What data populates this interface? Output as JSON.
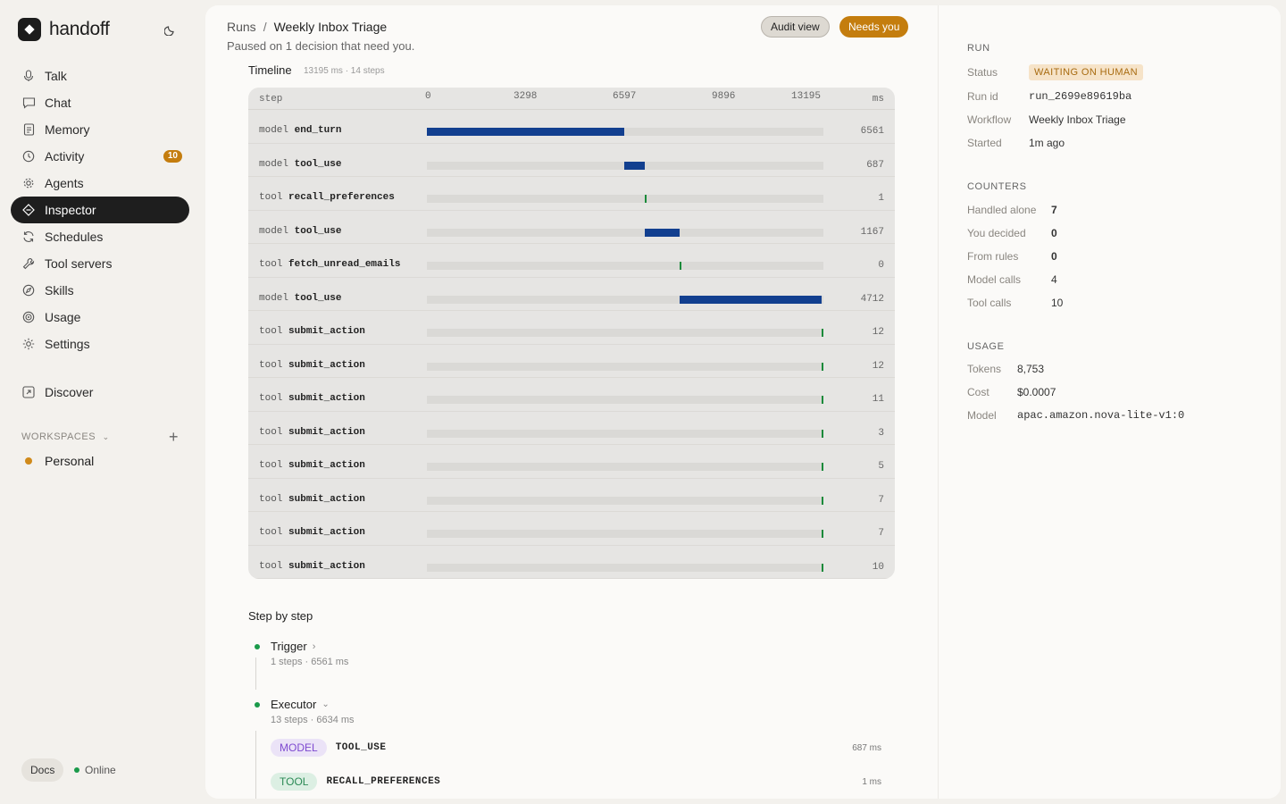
{
  "app": {
    "name": "handoff"
  },
  "nav": [
    {
      "label": "Talk",
      "icon": "mic-icon"
    },
    {
      "label": "Chat",
      "icon": "chat-icon"
    },
    {
      "label": "Memory",
      "icon": "document-icon"
    },
    {
      "label": "Activity",
      "icon": "clock-icon",
      "badge": "10"
    },
    {
      "label": "Agents",
      "icon": "gear-cog-icon"
    },
    {
      "label": "Inspector",
      "icon": "diamond-icon",
      "active": true
    },
    {
      "label": "Schedules",
      "icon": "refresh-icon"
    },
    {
      "label": "Tool servers",
      "icon": "wrench-icon"
    },
    {
      "label": "Skills",
      "icon": "compass-icon"
    },
    {
      "label": "Usage",
      "icon": "target-icon"
    },
    {
      "label": "Settings",
      "icon": "sun-gear-icon"
    }
  ],
  "discover": {
    "label": "Discover"
  },
  "workspaces": {
    "label": "WORKSPACES",
    "items": [
      "Personal"
    ]
  },
  "footer": {
    "docs": "Docs",
    "status": "Online"
  },
  "header": {
    "crumb_root": "Runs",
    "crumb_sep": "/",
    "crumb_current": "Weekly Inbox Triage",
    "subtitle": "Paused on 1 decision that need you.",
    "audit_label": "Audit view",
    "needs_label": "Needs you"
  },
  "timeline": {
    "title": "Timeline",
    "meta": "13195 ms · 14 steps",
    "col_step": "step",
    "col_ms": "ms",
    "ticks": [
      "0",
      "3298",
      "6597",
      "9896",
      "13195"
    ],
    "total_ms": 13195,
    "rows": [
      {
        "kind": "model",
        "name": "end_turn",
        "start": 0,
        "dur": 6561,
        "value": "6561"
      },
      {
        "kind": "model",
        "name": "tool_use",
        "start": 6561,
        "dur": 687,
        "value": "687"
      },
      {
        "kind": "tool",
        "name": "recall_preferences",
        "start": 7248,
        "dur": 1,
        "value": "1"
      },
      {
        "kind": "model",
        "name": "tool_use",
        "start": 7249,
        "dur": 1167,
        "value": "1167"
      },
      {
        "kind": "tool",
        "name": "fetch_unread_emails",
        "start": 8416,
        "dur": 0,
        "value": "0"
      },
      {
        "kind": "model",
        "name": "tool_use",
        "start": 8416,
        "dur": 4712,
        "value": "4712"
      },
      {
        "kind": "tool",
        "name": "submit_action",
        "start": 13128,
        "dur": 12,
        "value": "12"
      },
      {
        "kind": "tool",
        "name": "submit_action",
        "start": 13140,
        "dur": 12,
        "value": "12"
      },
      {
        "kind": "tool",
        "name": "submit_action",
        "start": 13152,
        "dur": 11,
        "value": "11"
      },
      {
        "kind": "tool",
        "name": "submit_action",
        "start": 13163,
        "dur": 3,
        "value": "3"
      },
      {
        "kind": "tool",
        "name": "submit_action",
        "start": 13166,
        "dur": 5,
        "value": "5"
      },
      {
        "kind": "tool",
        "name": "submit_action",
        "start": 13171,
        "dur": 7,
        "value": "7"
      },
      {
        "kind": "tool",
        "name": "submit_action",
        "start": 13178,
        "dur": 7,
        "value": "7"
      },
      {
        "kind": "tool",
        "name": "submit_action",
        "start": 13185,
        "dur": 10,
        "value": "10"
      }
    ]
  },
  "step_by_step": {
    "title": "Step by step",
    "trigger": {
      "label": "Trigger",
      "meta": "1 steps · 6561 ms"
    },
    "executor": {
      "label": "Executor",
      "meta": "13 steps · 6634 ms"
    },
    "steps": [
      {
        "pill": "MODEL",
        "kind": "model",
        "name": "TOOL_USE",
        "ms": "687 ms"
      },
      {
        "pill": "TOOL",
        "kind": "tool",
        "name": "RECALL_PREFERENCES",
        "ms": "1 ms"
      }
    ]
  },
  "run": {
    "section": "RUN",
    "status_label": "Status",
    "status": "WAITING ON HUMAN",
    "id_label": "Run id",
    "id": "run_2699e89619ba",
    "workflow_label": "Workflow",
    "workflow": "Weekly Inbox Triage",
    "started_label": "Started",
    "started": "1m ago"
  },
  "counters": {
    "section": "COUNTERS",
    "items": [
      {
        "label": "Handled alone",
        "value": "7"
      },
      {
        "label": "You decided",
        "value": "0"
      },
      {
        "label": "From rules",
        "value": "0"
      },
      {
        "label": "Model calls",
        "value": "4"
      },
      {
        "label": "Tool calls",
        "value": "10"
      }
    ]
  },
  "usage": {
    "section": "USAGE",
    "tokens_label": "Tokens",
    "tokens": "8,753",
    "cost_label": "Cost",
    "cost": "$0.0007",
    "model_label": "Model",
    "model": "apac.amazon.nova-lite-v1:0"
  },
  "colors": {
    "accent": "#c47d0e",
    "bar": "#123f8f",
    "tick": "#1a8a3a",
    "active_nav": "#1e1e1e"
  }
}
